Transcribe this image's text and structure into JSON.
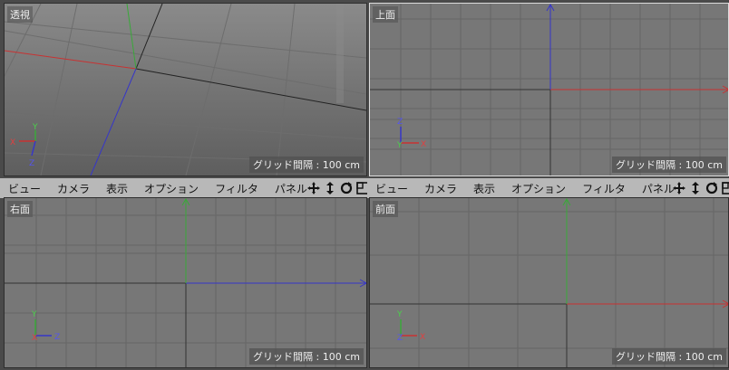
{
  "menu_items": [
    "ビュー",
    "カメラ",
    "表示",
    "オプション",
    "フィルタ",
    "パネル"
  ],
  "viewports": {
    "perspective": {
      "label": "透視",
      "grid_info": "グリッド間隔 : 100 cm"
    },
    "top": {
      "label": "上面",
      "grid_info": "グリッド間隔 : 100 cm"
    },
    "right": {
      "label": "右面",
      "grid_info": "グリッド間隔 : 100 cm"
    },
    "front": {
      "label": "前面",
      "grid_info": "グリッド間隔 : 100 cm"
    }
  },
  "axis_labels": {
    "x": "X",
    "y": "Y",
    "z": "Z"
  },
  "toolbar_icons": [
    "move-view-icon",
    "zoom-view-icon",
    "rotate-view-icon",
    "toggle-layout-icon"
  ],
  "colors": {
    "x_axis": "#c83232",
    "y_axis": "#3aa83a",
    "z_axis": "#3636c8",
    "grid": "#666666",
    "viewport_bg": "#787878"
  }
}
